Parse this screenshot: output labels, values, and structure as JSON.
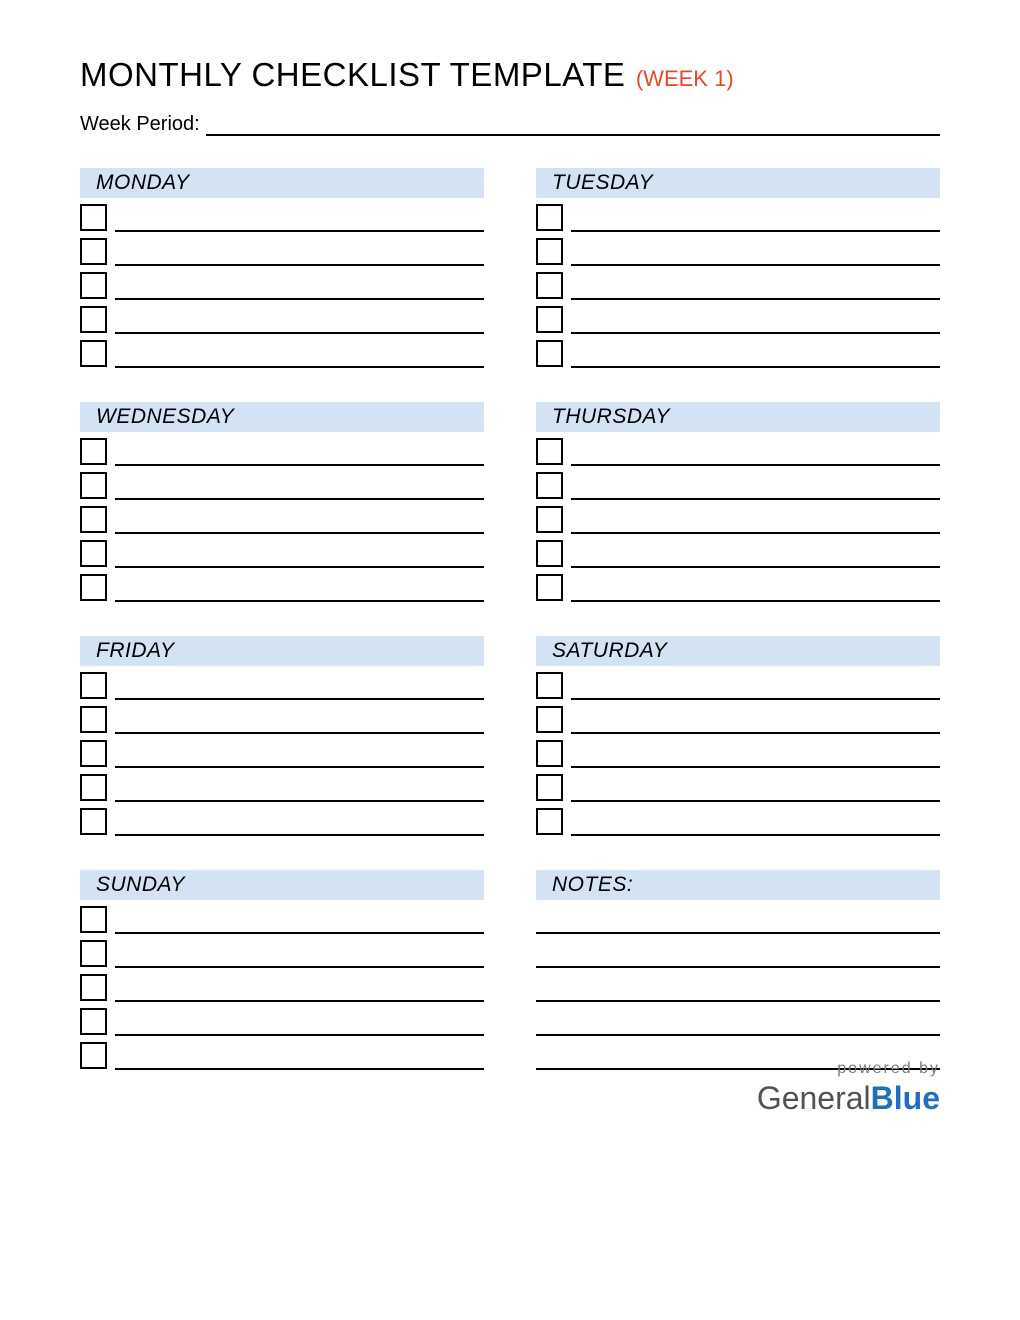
{
  "title_main": "MONTHLY CHECKLIST TEMPLATE",
  "title_sub": "(WEEK 1)",
  "week_period_label": "Week Period:",
  "days": {
    "monday": "MONDAY",
    "tuesday": "TUESDAY",
    "wednesday": "WEDNESDAY",
    "thursday": "THURSDAY",
    "friday": "FRIDAY",
    "saturday": "SATURDAY",
    "sunday": "SUNDAY"
  },
  "notes_label": "NOTES:",
  "rows_per_day": 5,
  "footer": {
    "powered": "powered by",
    "brand_general": "General",
    "brand_blue": "Blue"
  }
}
